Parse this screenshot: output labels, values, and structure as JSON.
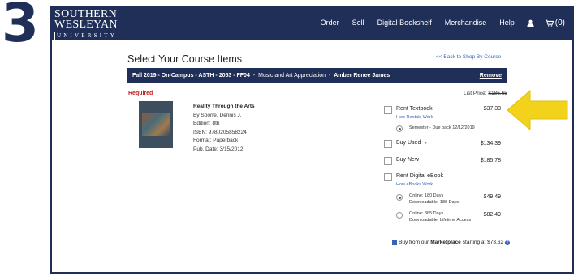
{
  "step_number": "3",
  "header": {
    "logo": {
      "line1": "SOUTHERN",
      "line2": "WESLEYAN",
      "line3": "UNIVERSITY"
    },
    "nav": [
      "Order",
      "Sell",
      "Digital Bookshelf",
      "Merchandise",
      "Help"
    ],
    "user_icon": "user-icon",
    "cart_icon": "cart-icon",
    "cart_count": "(0)"
  },
  "page": {
    "title": "Select Your Course Items",
    "back_link": "<< Back to Shop By Course"
  },
  "course": {
    "term": "Fall 2019 - On-Campus - ASTH - 2053 - FF04",
    "description": "Music and Art Appreciation",
    "instructor": "Amber Renee James",
    "remove_label": "Remove"
  },
  "item": {
    "required_label": "Required",
    "list_price_label": "List Price:",
    "list_price": "$186.65",
    "title": "Reality Through the Arts",
    "author": "By Sporre, Dennis J.",
    "edition": "Edition: 8th",
    "isbn": "ISBN: 9780205858224",
    "format": "Format: Paperback",
    "pub_date": "Pub. Date: 3/15/2012"
  },
  "options": {
    "rent_textbook": {
      "label": "Rent Textbook",
      "link": "How Rentals Work",
      "price": "$37.33",
      "term_label": "Semester",
      "term_due": "- Due back 12/12/2019"
    },
    "buy_used": {
      "label": "Buy Used",
      "price": "$134.39"
    },
    "buy_new": {
      "label": "Buy New",
      "price": "$185.78"
    },
    "rent_ebook": {
      "label": "Rent Digital eBook",
      "link": "How eBooks Work",
      "choices": [
        {
          "line1": "Online: 180 Days",
          "line2": "Downloadable: 180 Days",
          "price": "$49.49",
          "selected": true
        },
        {
          "line1": "Online: 365 Days",
          "line2": "Downloadable: Lifetime Access",
          "price": "$82.49",
          "selected": false
        }
      ]
    }
  },
  "marketplace": {
    "prefix": "Buy from our",
    "name": "Marketplace",
    "suffix": "starting at $73.62"
  },
  "colors": {
    "navy": "#1f2f57",
    "link": "#3b63b5",
    "required": "#c02020",
    "arrow": "#f2d21a"
  }
}
